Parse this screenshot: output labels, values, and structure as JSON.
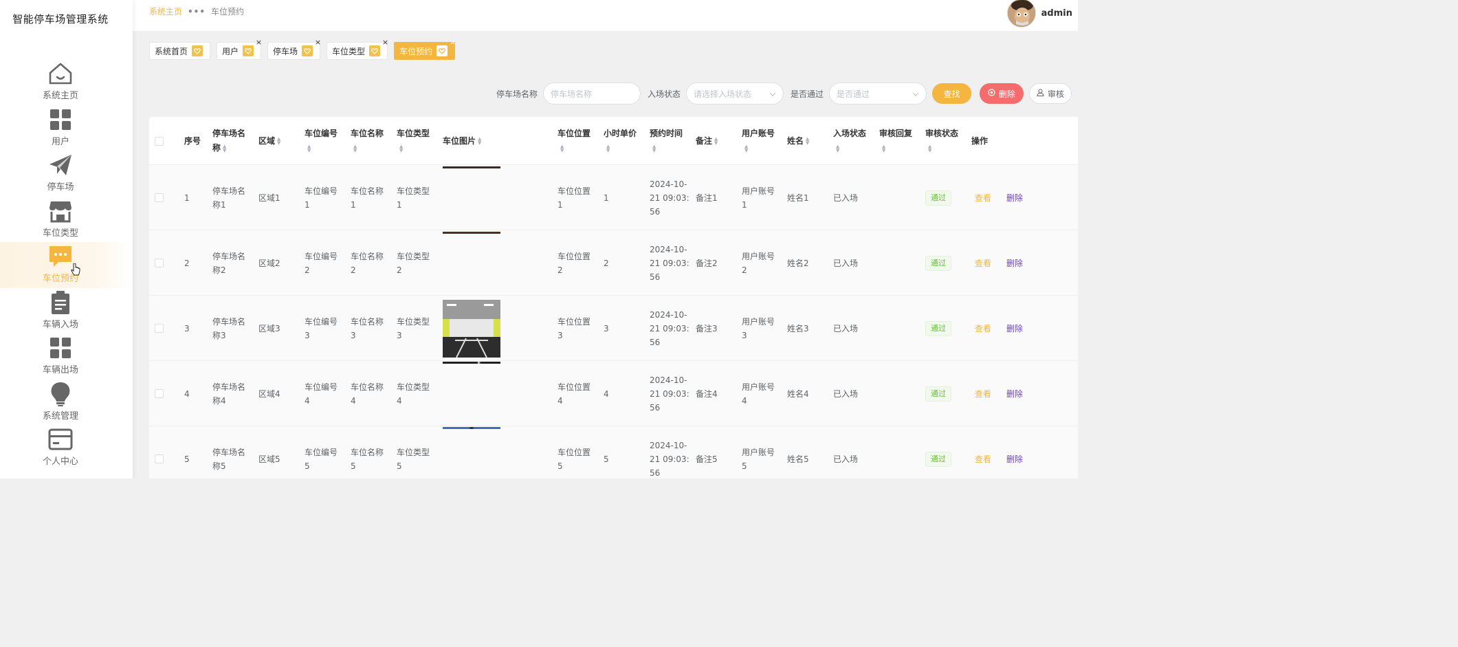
{
  "system_title": "智能停车场管理系统",
  "sidebar": {
    "items": [
      {
        "label": "系统主页",
        "icon": "home-icon",
        "active": false
      },
      {
        "label": "用户",
        "icon": "grid-icon",
        "active": false
      },
      {
        "label": "停车场",
        "icon": "paper-plane-icon",
        "active": false
      },
      {
        "label": "车位类型",
        "icon": "store-icon",
        "active": false
      },
      {
        "label": "车位预约",
        "icon": "chat-bubble-icon",
        "active": true
      },
      {
        "label": "车辆入场",
        "icon": "clipboard-icon",
        "active": false
      },
      {
        "label": "车辆出场",
        "icon": "grid-icon",
        "active": false
      },
      {
        "label": "系统管理",
        "icon": "lightbulb-icon",
        "active": false
      },
      {
        "label": "个人中心",
        "icon": "card-icon",
        "active": false
      }
    ]
  },
  "header": {
    "breadcrumb_home": "系统主页",
    "breadcrumb_sep": "•••",
    "breadcrumb_current": "车位预约",
    "username": "admin"
  },
  "tags": [
    {
      "label": "系统首页",
      "closable": false,
      "active": false
    },
    {
      "label": "用户",
      "closable": true,
      "active": false
    },
    {
      "label": "停车场",
      "closable": true,
      "active": false
    },
    {
      "label": "车位类型",
      "closable": true,
      "active": false
    },
    {
      "label": "车位预约",
      "closable": true,
      "active": true
    }
  ],
  "tag_close": "×",
  "search": {
    "lot_name_label": "停车场名称",
    "lot_name_placeholder": "停车场名称",
    "entry_status_label": "入场状态",
    "entry_status_placeholder": "请选择入场状态",
    "approved_label": "是否通过",
    "approved_placeholder": "是否通过",
    "find_label": "查找",
    "delete_label": "删除",
    "audit_label": "审核"
  },
  "table": {
    "headers": {
      "index": "序号",
      "lot_name": "停车场名称",
      "area": "区域",
      "spot_no": "车位编号",
      "spot_name": "车位名称",
      "spot_type": "车位类型",
      "spot_image": "车位图片",
      "spot_location": "车位位置",
      "hourly_price": "小时单价",
      "reserve_time": "预约时间",
      "note": "备注",
      "user_account": "用户账号",
      "name": "姓名",
      "entry_status": "入场状态",
      "audit_reply": "审核回复",
      "audit_status": "审核状态",
      "actions": "操作"
    },
    "rows": [
      {
        "index": "1",
        "lot_name": "停车场名称1",
        "area": "区域1",
        "spot_no": "车位编号1",
        "spot_name": "车位名称1",
        "spot_type": "车位类型1",
        "spot_location": "车位位置1",
        "hourly_price": "1",
        "reserve_time": "2024-10-21 09:03:56",
        "note": "备注1",
        "user_account": "用户账号1",
        "name": "姓名1",
        "entry_status": "已入场",
        "audit_reply": "",
        "audit_status": "通过",
        "view": "查看",
        "delete": "删除",
        "image": "line-dark"
      },
      {
        "index": "2",
        "lot_name": "停车场名称2",
        "area": "区域2",
        "spot_no": "车位编号2",
        "spot_name": "车位名称2",
        "spot_type": "车位类型2",
        "spot_location": "车位位置2",
        "hourly_price": "2",
        "reserve_time": "2024-10-21 09:03:56",
        "note": "备注2",
        "user_account": "用户账号2",
        "name": "姓名2",
        "entry_status": "已入场",
        "audit_reply": "",
        "audit_status": "通过",
        "view": "查看",
        "delete": "删除",
        "image": "line-brown"
      },
      {
        "index": "3",
        "lot_name": "停车场名称3",
        "area": "区域3",
        "spot_no": "车位编号3",
        "spot_name": "车位名称3",
        "spot_type": "车位类型3",
        "spot_location": "车位位置3",
        "hourly_price": "3",
        "reserve_time": "2024-10-21 09:03:56",
        "note": "备注3",
        "user_account": "用户账号3",
        "name": "姓名3",
        "entry_status": "已入场",
        "audit_reply": "",
        "audit_status": "通过",
        "view": "查看",
        "delete": "删除",
        "image": "garage-photo"
      },
      {
        "index": "4",
        "lot_name": "停车场名称4",
        "area": "区域4",
        "spot_no": "车位编号4",
        "spot_name": "车位名称4",
        "spot_type": "车位类型4",
        "spot_location": "车位位置4",
        "hourly_price": "4",
        "reserve_time": "2024-10-21 09:03:56",
        "note": "备注4",
        "user_account": "用户账号4",
        "name": "姓名4",
        "entry_status": "已入场",
        "audit_reply": "",
        "audit_status": "通过",
        "view": "查看",
        "delete": "删除",
        "image": "line-dark"
      },
      {
        "index": "5",
        "lot_name": "停车场名称5",
        "area": "区域5",
        "spot_no": "车位编号5",
        "spot_name": "车位名称5",
        "spot_type": "车位类型5",
        "spot_location": "车位位置5",
        "hourly_price": "5",
        "reserve_time": "2024-10-21 09:03:56",
        "note": "备注5",
        "user_account": "用户账号5",
        "name": "姓名5",
        "entry_status": "已入场",
        "audit_reply": "",
        "audit_status": "通过",
        "view": "查看",
        "delete": "删除",
        "image": "line-blue"
      }
    ]
  },
  "colors": {
    "accent": "#f4b63e",
    "danger": "#f56c6c",
    "success": "#67c23a",
    "link_purple": "#6f42c1"
  }
}
